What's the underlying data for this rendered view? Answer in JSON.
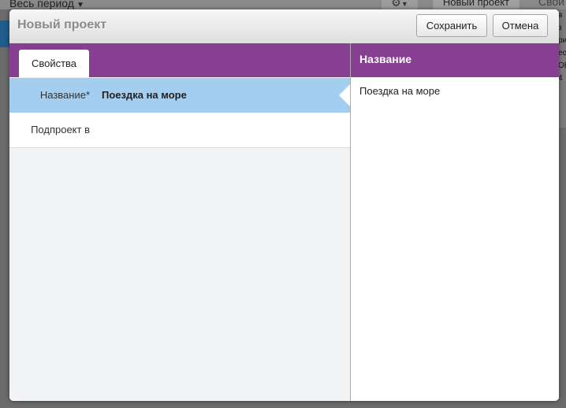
{
  "background": {
    "period_label": "Весь период",
    "new_project_label": "Новый проект",
    "right_label": "Свой",
    "right_col": [
      "в",
      "з",
      "ри",
      "ес",
      "ОЕ",
      "4"
    ]
  },
  "dialog": {
    "title": "Новый проект",
    "save_label": "Сохранить",
    "cancel_label": "Отмена"
  },
  "properties": {
    "tab_label": "Свойства",
    "rows": [
      {
        "label": "Название*",
        "value": "Поездка на море"
      },
      {
        "label": "Подпроект в",
        "value": ""
      }
    ]
  },
  "detail": {
    "header": "Название",
    "value": "Поездка на море"
  },
  "colors": {
    "accent": "#873f91",
    "selected_row": "#a3cef0",
    "panel_bg": "#f2f3f5"
  }
}
